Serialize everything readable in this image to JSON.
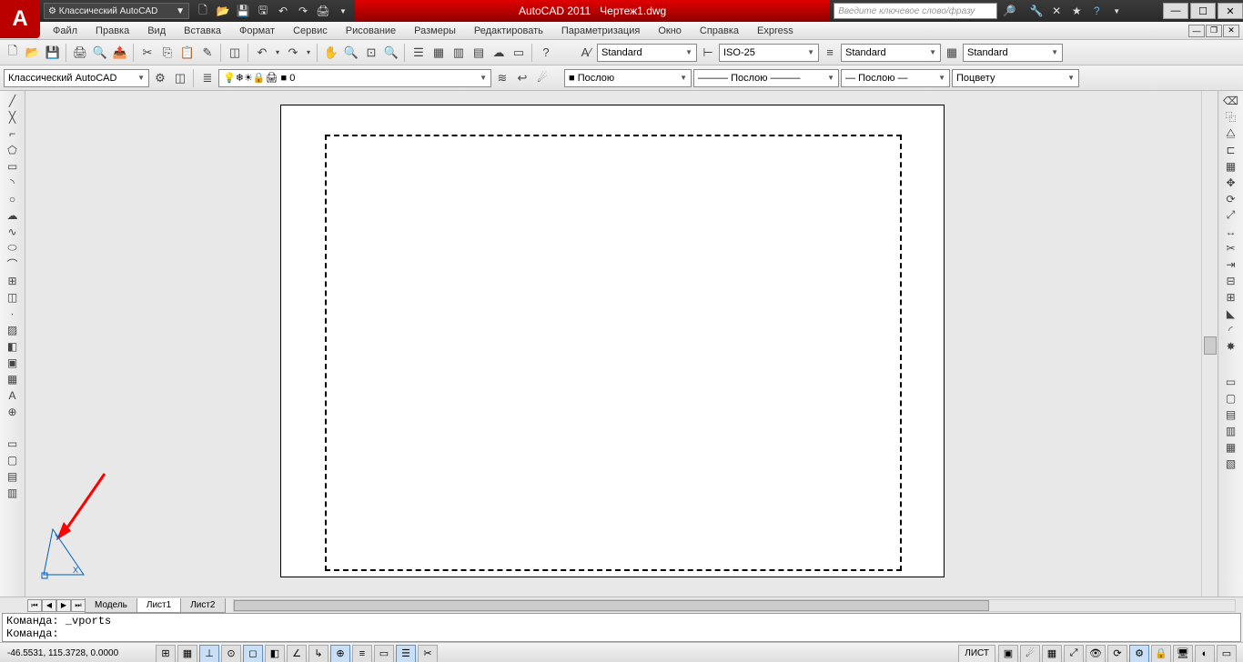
{
  "app": {
    "title": "AutoCAD 2011",
    "filename": "Чертеж1.dwg",
    "workspace": "Классический AutoCAD",
    "search_ph": "Введите ключевое слово/фразу"
  },
  "menu": [
    "Файл",
    "Правка",
    "Вид",
    "Вставка",
    "Формат",
    "Сервис",
    "Рисование",
    "Размеры",
    "Редактировать",
    "Параметризация",
    "Окно",
    "Справка",
    "Express"
  ],
  "styles": {
    "text": "Standard",
    "dim": "ISO-25",
    "ml": "Standard",
    "table": "Standard"
  },
  "layers": {
    "current": "0",
    "workspace_dd": "Классический AutoCAD"
  },
  "props": {
    "color": "Послою",
    "ltype": "Послою",
    "lweight": "Послою",
    "plot": "Поцвету"
  },
  "tabs": {
    "model": "Модель",
    "l1": "Лист1",
    "l2": "Лист2"
  },
  "cmd": {
    "line1": "Команда: _vports",
    "line2": "Команда:"
  },
  "status": {
    "coords": "-46.5531, 115.3728, 0.0000",
    "space": "ЛИСТ"
  },
  "colors": {
    "accent": "#d00000"
  }
}
